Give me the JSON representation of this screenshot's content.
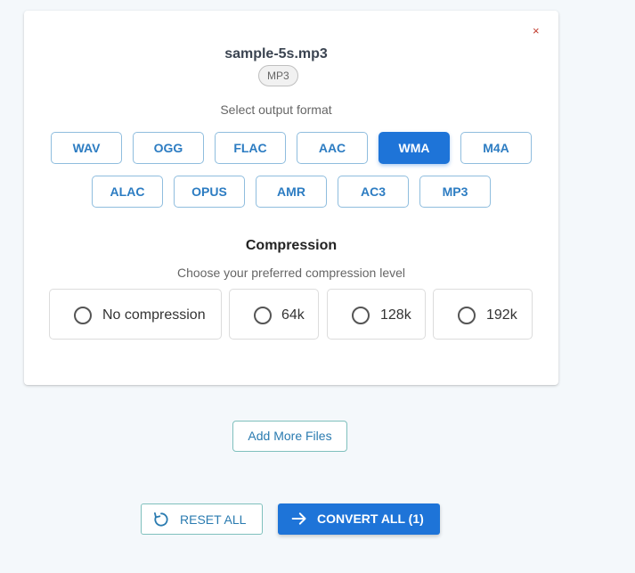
{
  "file": {
    "name": "sample-5s.mp3",
    "badge": "MP3",
    "close_label": "×"
  },
  "format": {
    "label": "Select output format",
    "selected": "WMA",
    "options": [
      "WAV",
      "OGG",
      "FLAC",
      "AAC",
      "WMA",
      "M4A",
      "ALAC",
      "OPUS",
      "AMR",
      "AC3",
      "MP3"
    ]
  },
  "compression": {
    "title": "Compression",
    "subtitle": "Choose your preferred compression level",
    "options": [
      "No compression",
      "64k",
      "128k",
      "192k"
    ]
  },
  "actions": {
    "add_more": "Add More Files",
    "reset_all": "RESET ALL",
    "convert_all": "CONVERT ALL (1)"
  },
  "colors": {
    "accent": "#1e74d8",
    "background": "#f4f8fb",
    "close": "#c0392b"
  },
  "icons": {
    "close": "close-icon",
    "reset": "reset-icon",
    "convert": "arrow-right-icon"
  }
}
